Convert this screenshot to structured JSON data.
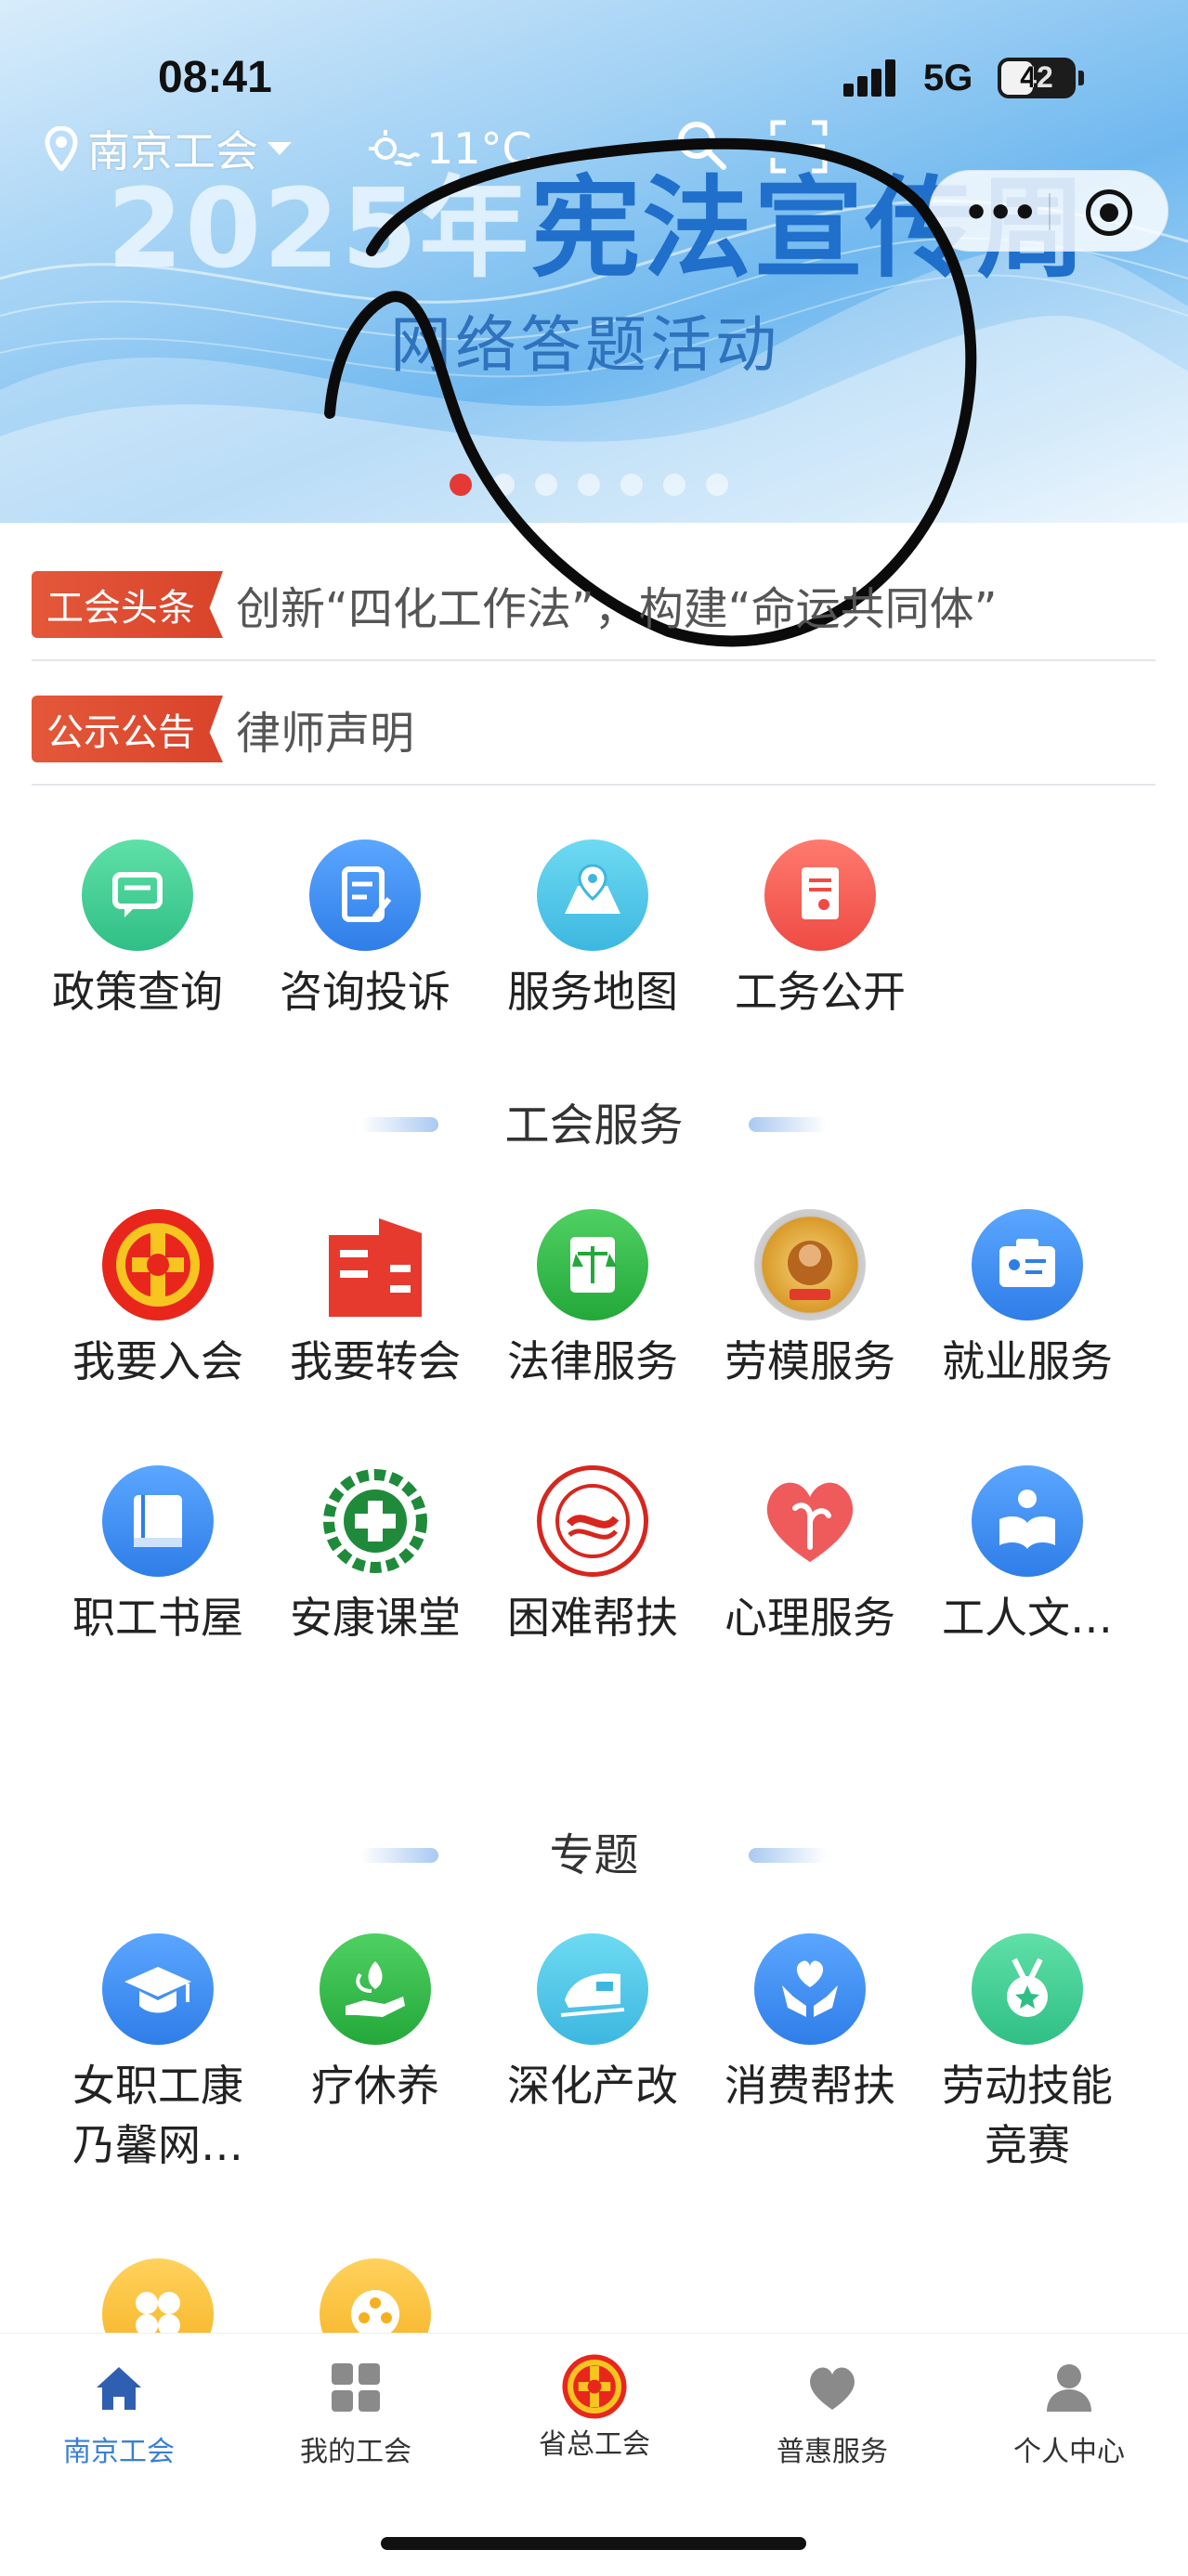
{
  "status_bar": {
    "time": "08:41",
    "network": "5G",
    "battery": "42"
  },
  "header": {
    "location": "南京工会",
    "temperature": "11°C"
  },
  "banner": {
    "title_year": "2025年",
    "title_rest": "宪法宣传周",
    "subtitle": "网络答题活动",
    "slide_count": 7,
    "active_slide": 1
  },
  "news": [
    {
      "tag": "工会头条",
      "text": "创新“四化工作法”，构建“命运共同体”"
    },
    {
      "tag": "公示公告",
      "text": "律师声明"
    }
  ],
  "quick_links": [
    {
      "label": "政策查询",
      "icon": "chat-icon",
      "color": "#3ecf93"
    },
    {
      "label": "咨询投诉",
      "icon": "document-edit-icon",
      "color": "#3d8ef0"
    },
    {
      "label": "服务地图",
      "icon": "map-icon",
      "color": "#46c4e6"
    },
    {
      "label": "工务公开",
      "icon": "report-icon",
      "color": "#f0564f"
    }
  ],
  "union_services": {
    "title": "工会服务",
    "items": [
      {
        "label": "我要入会",
        "icon": "union-emblem-icon"
      },
      {
        "label": "我要转会",
        "icon": "building-icon"
      },
      {
        "label": "法律服务",
        "icon": "law-book-icon"
      },
      {
        "label": "劳模服务",
        "icon": "model-worker-badge-icon"
      },
      {
        "label": "就业服务",
        "icon": "id-card-icon"
      },
      {
        "label": "职工书屋",
        "icon": "book-icon"
      },
      {
        "label": "安康课堂",
        "icon": "safety-cross-gear-icon"
      },
      {
        "label": "困难帮扶",
        "icon": "aid-seal-icon"
      },
      {
        "label": "心理服务",
        "icon": "heart-leaf-icon"
      },
      {
        "label": "工人文…",
        "icon": "reading-icon"
      }
    ]
  },
  "topics": {
    "title": "专题",
    "items": [
      {
        "label": "女职工康乃馨网…",
        "icon": "graduation-cap-icon"
      },
      {
        "label": "疗休养",
        "icon": "hand-leaf-icon"
      },
      {
        "label": "深化产改",
        "icon": "train-icon"
      },
      {
        "label": "消费帮扶",
        "icon": "hands-heart-icon"
      },
      {
        "label": "劳动技能竞赛",
        "icon": "medal-icon"
      },
      {
        "label": "",
        "icon": "clover-icon"
      },
      {
        "label": "",
        "icon": "film-reel-icon"
      }
    ]
  },
  "tabbar": [
    {
      "label": "南京工会",
      "icon": "home-icon",
      "active": true
    },
    {
      "label": "我的工会",
      "icon": "grid-icon",
      "active": false
    },
    {
      "label": "省总工会",
      "icon": "union-emblem-icon",
      "active": false
    },
    {
      "label": "普惠服务",
      "icon": "heart-icon",
      "active": false
    },
    {
      "label": "个人中心",
      "icon": "person-icon",
      "active": false
    }
  ],
  "colors": {
    "accent": "#3a7fd5",
    "tag_red": "#dd4a2f",
    "banner_blue": "#1f6fcb"
  }
}
